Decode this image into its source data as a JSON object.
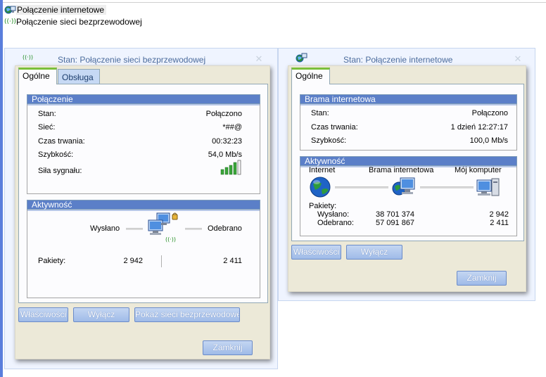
{
  "connections": [
    {
      "label": "Połączenie internetowe",
      "icon": "network-globe-icon"
    },
    {
      "label": "Połączenie sieci bezprzewodowej",
      "icon": "wireless-icon"
    }
  ],
  "wireless_dialog": {
    "title": "Stan: Połączenie sieci bezprzewodowej",
    "tabs": [
      "Ogólne",
      "Obsługa"
    ],
    "connection": {
      "header": "Połączenie",
      "rows": [
        {
          "label": "Stan:",
          "value": "Połączono"
        },
        {
          "label": "Sieć:",
          "value": "*##@"
        },
        {
          "label": "Czas trwania:",
          "value": "00:32:23"
        },
        {
          "label": "Szybkość:",
          "value": "54,0 Mb/s"
        }
      ],
      "signal_label": "Siła sygnału:",
      "signal_bars": 5
    },
    "activity": {
      "header": "Aktywność",
      "sent_label": "Wysłano",
      "received_label": "Odebrano",
      "packets_label": "Pakiety:",
      "packets_sent": "2 942",
      "packets_received": "2 411"
    },
    "buttons": {
      "properties": "Właściwości",
      "disable": "Wyłącz",
      "show_networks": "Pokaż sieci bezprzewodowe",
      "close": "Zamknij"
    }
  },
  "internet_dialog": {
    "title": "Stan: Połączenie internetowe",
    "tabs": [
      "Ogólne"
    ],
    "gateway": {
      "header": "Brama internetowa",
      "rows": [
        {
          "label": "Stan:",
          "value": "Połączono"
        },
        {
          "label": "Czas trwania:",
          "value": "1 dzień 12:27:17"
        },
        {
          "label": "Szybkość:",
          "value": "100,0 Mb/s"
        }
      ]
    },
    "activity": {
      "header": "Aktywność",
      "nodes": [
        "Internet",
        "Brama internetowa",
        "Mój komputer"
      ],
      "packets_label": "Pakiety:",
      "sent_label": "Wysłano:",
      "received_label": "Odebrano:",
      "gateway_sent": "38 701 374",
      "gateway_received": "57 091 867",
      "computer_sent": "2 942",
      "computer_received": "2 411"
    },
    "buttons": {
      "properties": "Właściwości",
      "disable": "Wyłącz",
      "close": "Zamknij"
    }
  },
  "colors": {
    "group_header": "#5b7fc8",
    "tab_accent": "#7bbf3a",
    "button": "#a9c2ea",
    "signal_green": "#3aa53a"
  }
}
